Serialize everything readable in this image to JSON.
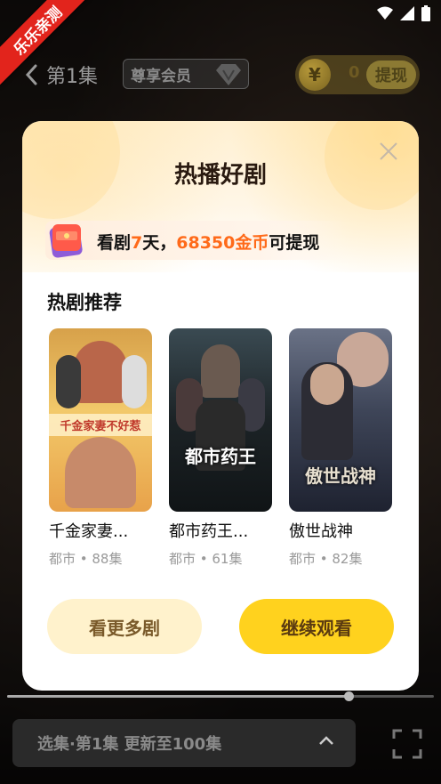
{
  "ribbon": {
    "label": "乐乐亲测"
  },
  "header": {
    "episode_title": "第1集",
    "vip_label": "尊享会员",
    "coin_symbol": "¥",
    "coin_count": "0",
    "withdraw_label": "提现"
  },
  "modal": {
    "title": "热播好剧",
    "promo": {
      "prefix": "看剧",
      "days": "7",
      "mid": "天，",
      "amount": "68350金币",
      "suffix": "可提现"
    },
    "section_title": "热剧推荐",
    "dramas": [
      {
        "title": "千金家妻...",
        "meta": "都市 • 88集",
        "poster_text": "千金家妻不好惹",
        "poster_color": "#e6b23c"
      },
      {
        "title": "都市药王...",
        "meta": "都市 • 61集",
        "poster_text": "都市药王",
        "poster_color": "#1f2a30"
      },
      {
        "title": "傲世战神",
        "meta": "都市 • 82集",
        "poster_text": "傲世战神",
        "poster_color": "#2e3648"
      }
    ],
    "more_button": "看更多剧",
    "continue_button": "继续观看"
  },
  "player": {
    "progress": 0.8,
    "episode_bar": "选集·第1集  更新至100集"
  },
  "colors": {
    "accent_orange": "#ff6a1a",
    "primary_yellow": "#ffd21e",
    "ribbon_red": "#e2241c"
  }
}
